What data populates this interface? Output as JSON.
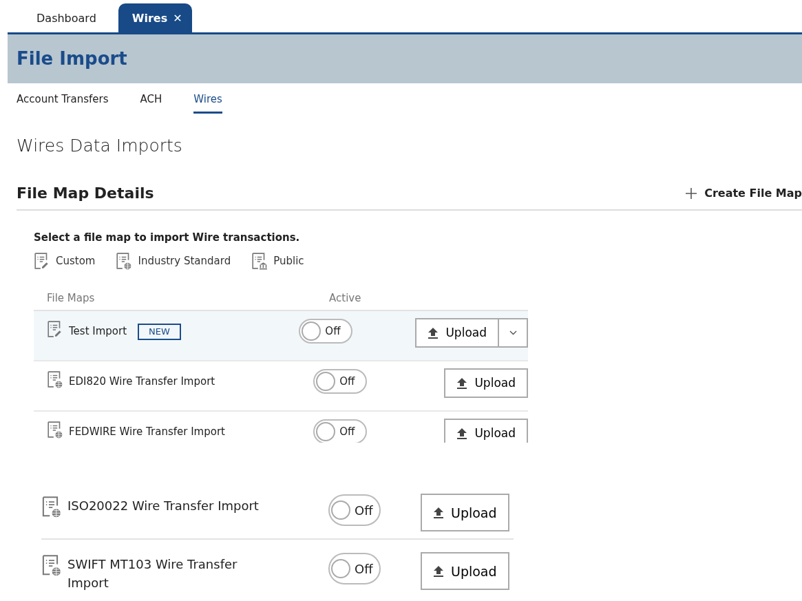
{
  "app_tabs": [
    {
      "label": "Dashboard",
      "selected": false,
      "closable": false
    },
    {
      "label": "Wires",
      "selected": true,
      "closable": true,
      "close_icon": "✕"
    }
  ],
  "header": {
    "title": "File Import"
  },
  "sub_tabs": [
    {
      "label": "Account Transfers",
      "selected": false
    },
    {
      "label": "ACH",
      "selected": false
    },
    {
      "label": "Wires",
      "selected": true
    }
  ],
  "page_title": "Wires Data Imports",
  "section": {
    "title": "File Map Details",
    "action": "Create File Map"
  },
  "instructions": "Select a file map to import Wire transactions.",
  "legend": [
    {
      "kind": "custom",
      "label": "Custom"
    },
    {
      "kind": "industry",
      "label": "Industry Standard"
    },
    {
      "kind": "public",
      "label": "Public"
    }
  ],
  "file_maps": {
    "columns": [
      "File Maps",
      "Active"
    ],
    "rows": [
      {
        "kind": "custom",
        "name": "Test Import",
        "badge": "NEW",
        "selected": true,
        "on": false,
        "toggle_label": "Off",
        "button": "Upload",
        "has_menu": true
      },
      {
        "kind": "industry",
        "name": "EDI820 Wire Transfer Import",
        "selected": false,
        "on": false,
        "toggle_label": "Off",
        "button": "Upload",
        "has_menu": false
      },
      {
        "kind": "industry",
        "name": "FEDWIRE Wire Transfer Import",
        "selected": false,
        "on": false,
        "toggle_label": "Off",
        "button": "Upload",
        "has_menu": false
      }
    ]
  },
  "more_rows": [
    {
      "kind": "industry",
      "name": "ISO20022 Wire Transfer Import",
      "on": false,
      "toggle_label": "Off",
      "button": "Upload"
    },
    {
      "kind": "industry",
      "name": "SWIFT MT103 Wire Transfer Import",
      "on": false,
      "toggle_label": "Off",
      "button": "Upload"
    }
  ]
}
